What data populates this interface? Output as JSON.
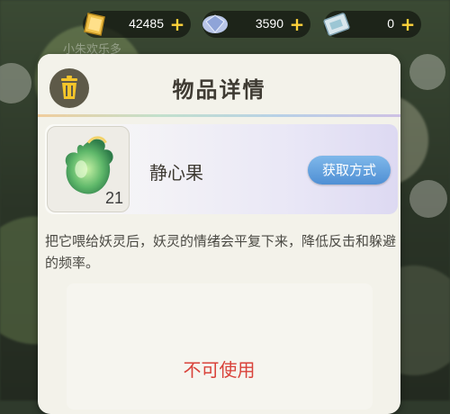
{
  "resources": [
    {
      "name": "gold",
      "icon": "gold-coin-icon",
      "value": "42485"
    },
    {
      "name": "diamond",
      "icon": "diamond-icon",
      "value": "3590"
    },
    {
      "name": "ticket",
      "icon": "ticket-icon",
      "value": "0"
    }
  ],
  "background": {
    "text_1": "小朱欢乐多"
  },
  "dialog": {
    "title": "物品详情",
    "item": {
      "name": "静心果",
      "count": "21",
      "obtain_label": "获取方式"
    },
    "description": "把它喂给妖灵后，妖灵的情绪会平复下来，降低反击和躲避的频率。",
    "status_label": "不可使用"
  },
  "colors": {
    "accent_blue": "#4f8fd4",
    "status_red": "#d9423a",
    "plus_yellow": "#ffd33a"
  }
}
